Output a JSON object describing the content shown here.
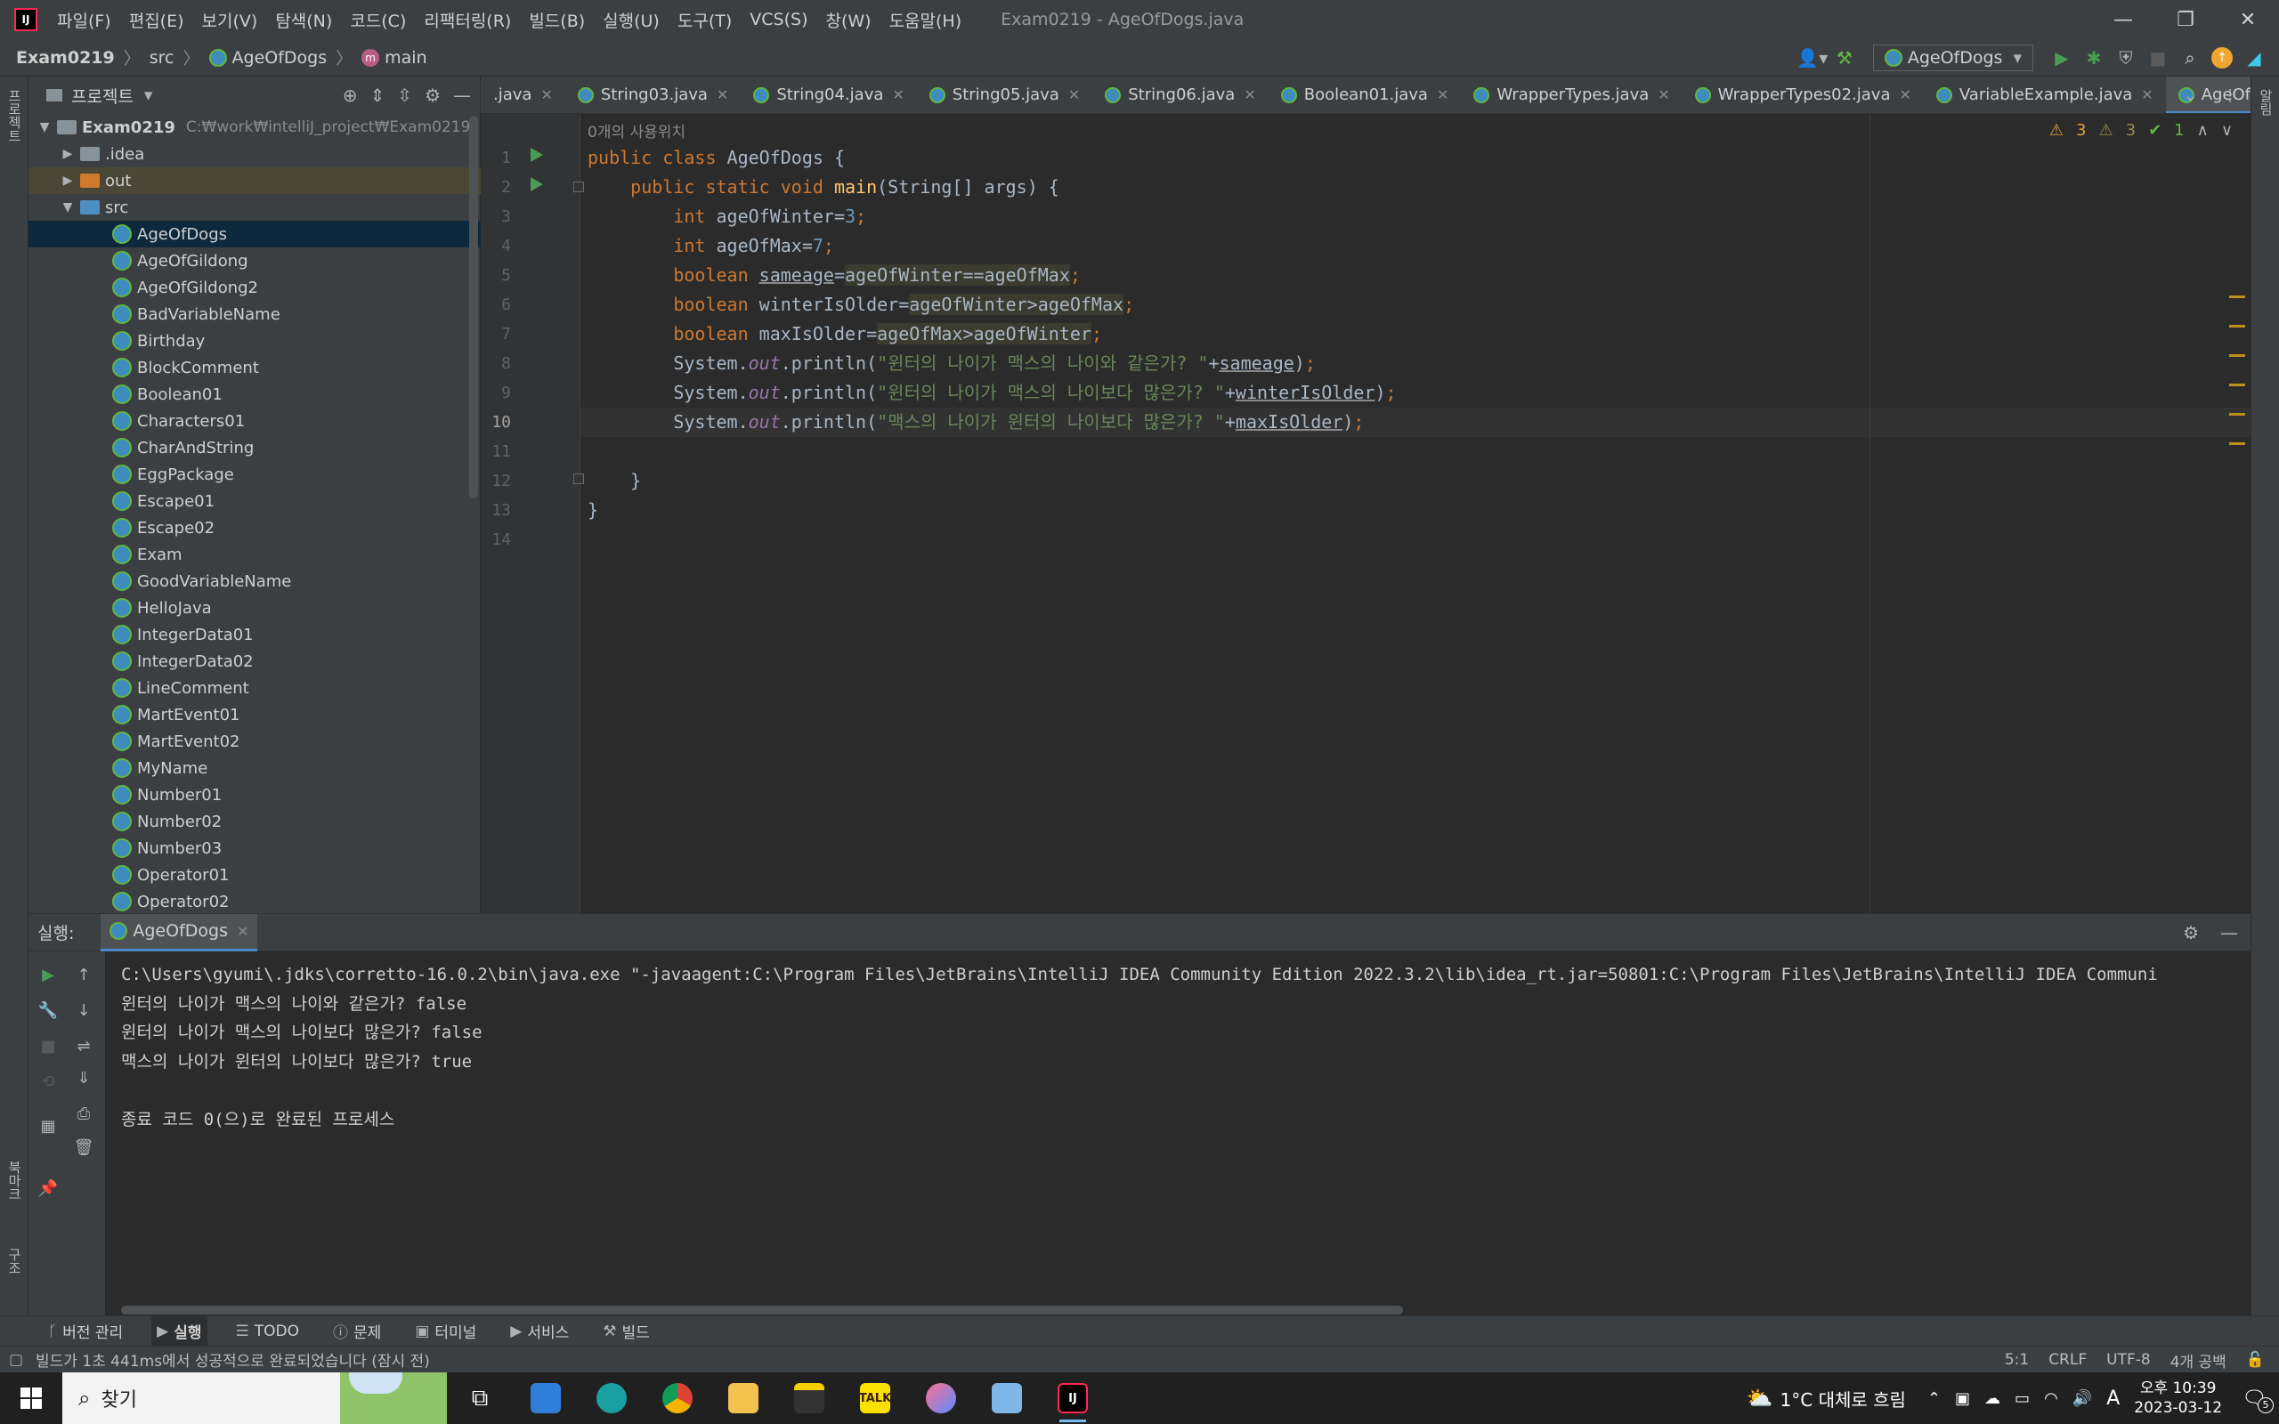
{
  "titlebar": {
    "app_logo": "IJ",
    "menu": [
      "파일(F)",
      "편집(E)",
      "보기(V)",
      "탐색(N)",
      "코드(C)",
      "리팩터링(R)",
      "빌드(B)",
      "실행(U)",
      "도구(T)",
      "VCS(S)",
      "창(W)",
      "도움말(H)"
    ],
    "window_title": "Exam0219 - AgeOfDogs.java",
    "controls": {
      "minimize": "—",
      "restore": "❐",
      "close": "✕"
    }
  },
  "navbar": {
    "crumbs": [
      "Exam0219",
      "src",
      "AgeOfDogs",
      "main"
    ],
    "run_config": "AgeOfDogs",
    "icons": [
      "user-icon",
      "hammer-icon",
      "run-icon",
      "debug-icon",
      "coverage-icon",
      "stop-icon",
      "search-icon",
      "update-icon",
      "toolbox-icon"
    ]
  },
  "left_strip": {
    "project": "프로젝트",
    "bookmarks": "북마크",
    "structure": "구조"
  },
  "right_strip": {
    "notifications": "알림"
  },
  "project": {
    "title": "프로젝트",
    "root": {
      "name": "Exam0219",
      "path": "C:₩work₩intelliJ_project₩Exam0219"
    },
    "folders": [
      ".idea",
      "out",
      "src"
    ],
    "files": [
      "AgeOfDogs",
      "AgeOfGildong",
      "AgeOfGildong2",
      "BadVariableName",
      "Birthday",
      "BlockComment",
      "Boolean01",
      "Characters01",
      "CharAndString",
      "EggPackage",
      "Escape01",
      "Escape02",
      "Exam",
      "GoodVariableName",
      "HelloJava",
      "IntegerData01",
      "IntegerData02",
      "LineComment",
      "MartEvent01",
      "MartEvent02",
      "MyName",
      "Number01",
      "Number02",
      "Number03",
      "Operator01",
      "Operator02"
    ]
  },
  "tabs": [
    {
      "label": ".java",
      "partial": true
    },
    {
      "label": "String03.java"
    },
    {
      "label": "String04.java"
    },
    {
      "label": "String05.java"
    },
    {
      "label": "String06.java"
    },
    {
      "label": "Boolean01.java"
    },
    {
      "label": "WrapperTypes.java"
    },
    {
      "label": "WrapperTypes02.java"
    },
    {
      "label": "VariableExample.java"
    },
    {
      "label": "AgeOfDogs.java",
      "active": true
    }
  ],
  "editor": {
    "usage_hint": "0개의 사용위치",
    "inspections": {
      "warnings": "3",
      "weak_warnings": "3",
      "ok": "1"
    },
    "line_numbers": [
      "1",
      "2",
      "3",
      "4",
      "5",
      "6",
      "7",
      "8",
      "9",
      "10",
      "11",
      "12",
      "13",
      "14"
    ],
    "current_line": "10"
  },
  "run": {
    "label": "실행:",
    "tab": "AgeOfDogs",
    "console": [
      "C:\\Users\\gyumi\\.jdks\\corretto-16.0.2\\bin\\java.exe \"-javaagent:C:\\Program Files\\JetBrains\\IntelliJ IDEA Community Edition 2022.3.2\\lib\\idea_rt.jar=50801:C:\\Program Files\\JetBrains\\IntelliJ IDEA Communi",
      "윈터의 나이가 맥스의 나이와 같은가? false",
      "윈터의 나이가 맥스의 나이보다 많은가? false",
      "맥스의 나이가 윈터의 나이보다 많은가? true",
      "",
      "종료 코드 0(으)로 완료된 프로세스"
    ]
  },
  "tool_windows": [
    {
      "label": "버전 관리",
      "glyph": "ᚴ"
    },
    {
      "label": "실행",
      "glyph": "▶",
      "active": true
    },
    {
      "label": "TODO",
      "glyph": "☰"
    },
    {
      "label": "문제",
      "glyph": "ⓘ"
    },
    {
      "label": "터미널",
      "glyph": "▣"
    },
    {
      "label": "서비스",
      "glyph": "▶"
    },
    {
      "label": "빌드",
      "glyph": "⚒"
    }
  ],
  "status": {
    "message": "빌드가 1초 441ms에서 성공적으로 완료되었습니다 (잠시 전)",
    "position": "5:1",
    "line_sep": "CRLF",
    "encoding": "UTF-8",
    "indent": "4개 공백"
  },
  "taskbar": {
    "search_placeholder": "찾기",
    "weather": "1°C 대체로 흐림",
    "time": "오후 10:39",
    "date": "2023-03-12",
    "notifications": "5",
    "ime": "A",
    "apps": [
      "task-view",
      "remote-desktop",
      "edge",
      "chrome",
      "file-explorer",
      "sticky-notes",
      "kakaotalk",
      "paint",
      "flight",
      "intellij"
    ],
    "kakao_label": "TALK",
    "intellij_label": "IJ"
  },
  "colors": {
    "accent": "#4a88c7",
    "run_green": "#499c54",
    "warning": "#e0a030",
    "selection": "#0d293e"
  }
}
